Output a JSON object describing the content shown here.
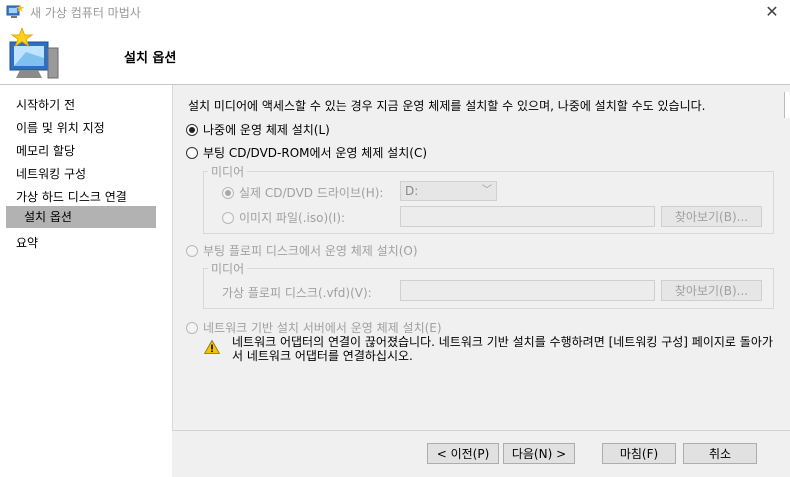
{
  "window": {
    "title": "새 가상 컴퓨터 마법사",
    "close_glyph": "✕"
  },
  "header": {
    "title": "설치 옵션"
  },
  "sidebar": {
    "items": [
      {
        "label": "시작하기 전",
        "selected": false
      },
      {
        "label": "이름 및 위치 지정",
        "selected": false
      },
      {
        "label": "메모리 할당",
        "selected": false
      },
      {
        "label": "네트워킹 구성",
        "selected": false
      },
      {
        "label": "가상 하드 디스크 연결",
        "selected": false
      },
      {
        "label": "설치 옵션",
        "selected": true
      },
      {
        "label": "요약",
        "selected": false
      }
    ]
  },
  "main": {
    "intro": "설치 미디어에 액세스할 수 있는 경우 지금 운영 체제를 설치할 수 있으며, 나중에 설치할 수도 있습니다.",
    "option_later": {
      "label": "나중에 운영 체제 설치(L)",
      "checked": true
    },
    "option_cd": {
      "label": "부팅 CD/DVD-ROM에서 운영 체제 설치(C)",
      "checked": false
    },
    "cd_media": {
      "group_label": "미디어",
      "physical": {
        "label": "실제 CD/DVD 드라이브(H):",
        "checked": true
      },
      "drive_value": "D:",
      "image": {
        "label": "이미지 파일(.iso)(I):",
        "checked": false
      },
      "browse_label": "찾아보기(B)..."
    },
    "option_floppy": {
      "label": "부팅 플로피 디스크에서 운영 체제 설치(O)",
      "checked": false
    },
    "floppy_media": {
      "group_label": "미디어",
      "vfd_label": "가상 플로피 디스크(.vfd)(V):",
      "browse_label": "찾아보기(B)..."
    },
    "option_network": {
      "label": "네트워크 기반 설치 서버에서 운영 체제 설치(E)",
      "checked": false
    },
    "warning": "네트워크 어댑터의 연결이 끊어졌습니다. 네트워크 기반 설치를 수행하려면 [네트워킹 구성] 페이지로 돌아가서 네트워크 어댑터를 연결하십시오."
  },
  "footer": {
    "prev_label": "< 이전(P)",
    "next_label": "다음(N) >",
    "finish_label": "마침(F)",
    "cancel_label": "취소"
  }
}
